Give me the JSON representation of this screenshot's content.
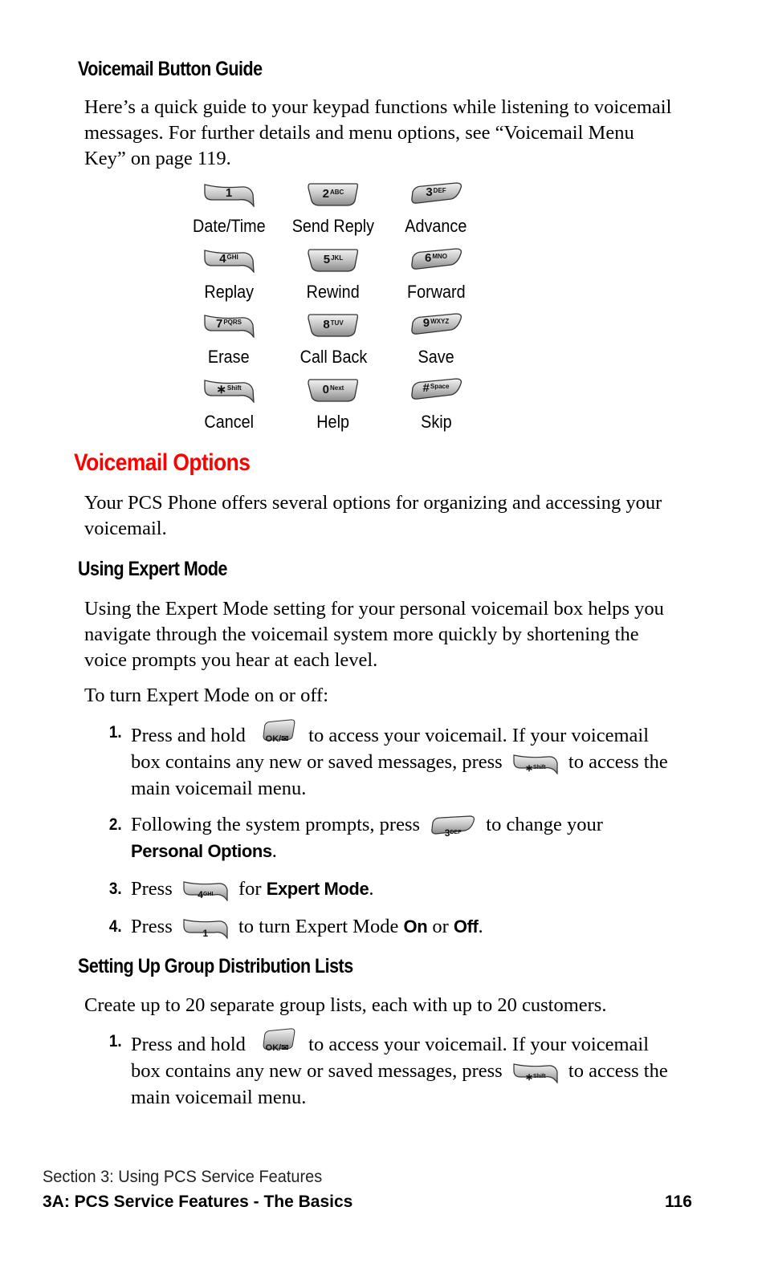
{
  "sections": {
    "button_guide": {
      "heading": "Voicemail Button Guide",
      "intro": "Here’s a quick guide to your keypad functions while listening to voicemail messages. For further details and menu options, see “Voicemail Menu Key” on page 119."
    },
    "keypad": [
      {
        "key": "1",
        "letters": "",
        "label": "Date/Time"
      },
      {
        "key": "2",
        "letters": "ABC",
        "label": "Send Reply"
      },
      {
        "key": "3",
        "letters": "DEF",
        "label": "Advance"
      },
      {
        "key": "4",
        "letters": "GHI",
        "label": "Replay"
      },
      {
        "key": "5",
        "letters": "JKL",
        "label": "Rewind"
      },
      {
        "key": "6",
        "letters": "MNO",
        "label": "Forward"
      },
      {
        "key": "7",
        "letters": "PQRS",
        "label": "Erase"
      },
      {
        "key": "8",
        "letters": "TUV",
        "label": "Call Back"
      },
      {
        "key": "9",
        "letters": "WXYZ",
        "label": "Save"
      },
      {
        "key": "∗",
        "letters": "Shift",
        "label": "Cancel"
      },
      {
        "key": "0",
        "letters": "Next",
        "label": "Help"
      },
      {
        "key": "#",
        "letters": "Space",
        "label": "Skip"
      }
    ],
    "options": {
      "heading": "Voicemail Options",
      "intro": "Your PCS Phone offers several options for organizing and accessing your voicemail."
    },
    "expert_mode": {
      "heading": "Using Expert Mode",
      "intro": "Using the Expert Mode setting for your personal voicemail box helps you navigate through the voicemail system more quickly by shortening the voice prompts you hear at each level.",
      "lead": "To turn Expert Mode on or off:",
      "steps": [
        {
          "num": "1.",
          "a": "Press and hold",
          "key1": "OK/✉",
          "b": "to access your voicemail. If your voicemail box contains any new or saved messages, press",
          "key2": "∗",
          "key2_sub": "Shift",
          "c": "to access the main voicemail menu."
        },
        {
          "num": "2.",
          "a": "Following the system prompts, press",
          "key1": "3",
          "key1_sub": "DEF",
          "b": "to change your",
          "bold": "Personal Options",
          "c": "."
        },
        {
          "num": "3.",
          "a": "Press",
          "key1": "4",
          "key1_sub": "GHI",
          "b": "for",
          "bold": "Expert Mode",
          "c": "."
        },
        {
          "num": "4.",
          "a": "Press",
          "key1": "1",
          "b": "to turn Expert Mode",
          "bold1": "On",
          "mid": "or",
          "bold2": "Off",
          "c": "."
        }
      ]
    },
    "group_lists": {
      "heading": "Setting Up Group Distribution Lists",
      "intro": "Create up to 20 separate group lists, each with up to 20 customers.",
      "steps": [
        {
          "num": "1.",
          "a": "Press and hold",
          "key1": "OK/✉",
          "b": "to access your voicemail. If your voicemail box contains any new or saved messages, press",
          "key2": "∗",
          "key2_sub": "Shift",
          "c": "to access the main voicemail menu."
        }
      ]
    }
  },
  "footer": {
    "section": "Section 3: Using PCS Service Features",
    "chapter": "3A: PCS Service Features - The Basics",
    "page": "116"
  },
  "colors": {
    "heading_accent": "#ff0000",
    "key_fill": "#c8c8c8"
  }
}
